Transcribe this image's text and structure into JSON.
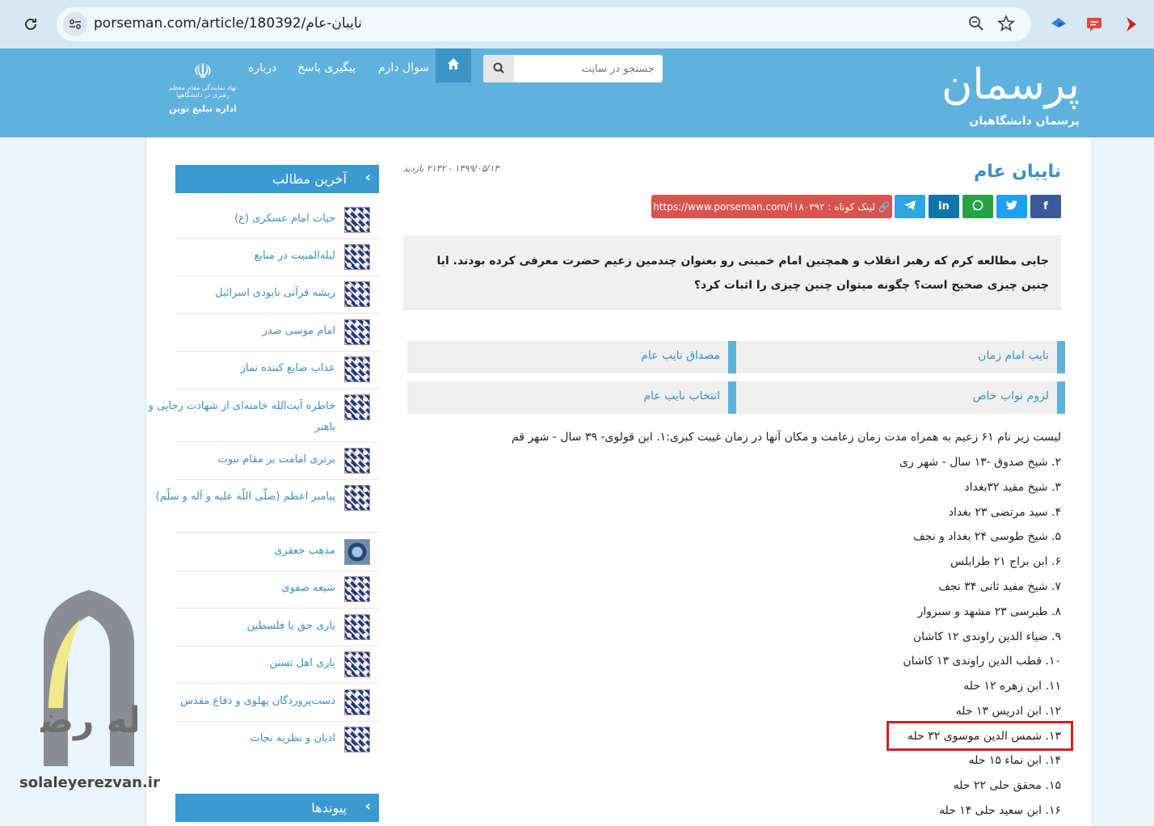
{
  "browser": {
    "url": "porseman.com/article/180392/نایبان-عام"
  },
  "header": {
    "logo_title": "پرسمان",
    "logo_subtitle": "پرسمان دانشگاهیان",
    "search_placeholder": "جستجو در سایت",
    "nav": [
      "سوال دارم",
      "پیگیری پاسخ",
      "درباره"
    ],
    "org_small": "نهاد نمایندگی مقام معظم رهبری در دانشگاهها",
    "org_name": "اداره تبلیغ نوین"
  },
  "article": {
    "title": "نایبان عام",
    "meta": "۱۳۹۹/۰۵/۱۳ - ۲۱۳۲ بازدید",
    "share": [
      "f",
      "t",
      "w",
      "in",
      "tg"
    ],
    "short_link": "لینک کوتاه : https://www.porseman.com/!۱۸۰۳۹۲",
    "question": "جایی مطالعه کرم که رهبر انقلاب و همچنین امام خمینی رو بعنوان چندمین زعیم حضرت معرفی کرده بودند. ایا چنین چیزی صحیح است؟ چگونه میتوان چنین چیزی را اثبات کرد؟",
    "tags": [
      "نایب امام زمان",
      "مصداق نایب عام",
      "لزوم نواب خاص",
      "انتخاب نایب عام"
    ],
    "list_lines": [
      "لیست زیر نام ۶۱ زعیم به همراه مدت زمان زعامت و مکان آنها در زمان غیبت کبری:۱. ابن قولوی- ۳۹ سال - شهر قم",
      "۲. شیخ صدوق -۱۳ سال - شهر ری",
      "۳. شیخ مفید ۳۲بغداد",
      "۴. سید مرتضی ۲۳ بغداد",
      "۵. شیخ طوسی ۲۴ بغداد و نجف",
      "۶. ابن براج ۲۱ طرابلس",
      "۷. شیخ مفید ثانی ۳۴ نجف",
      "۸. طبرسی ۲۳ مشهد و سبزوار",
      "۹. ضیاء الدین راوندی ۱۲ کاشان",
      "۱۰. قطب الدین راوندی ۱۳ کاشان",
      "۱۱. ابن زهره ۱۲ حله",
      "۱۲. ابن ادریس ۱۳ حله",
      "۱۳. شمس الدین موسوی ۳۲ حله",
      "۱۴. ابن نماء ۱۵ حله",
      "۱۵. محقق حلی ۲۲ حله",
      "۱۶. ابن سعید حلی ۱۴ حله"
    ]
  },
  "sidebar": {
    "latest_title": "آخرین مطالب",
    "links_title": "پیوندها",
    "items": [
      "حیات امام عسکری (ع)",
      "لیله‌المبیت در منابع",
      "ریشه قرآنی نابودی اسرائیل",
      "امام موسی صدر",
      "عذاب ضایع کننده نماز",
      "خاطره آیت‌الله خامنه‌ای از شهادت رجایی و باهنر",
      "برتری امامت بر مقام نبوت",
      "پیامبر اعظم (صلّی اللّه علیه و آله و سلّم)",
      "مذهب جعفری",
      "شیعه صفوی",
      "یاری حق یا فلسطین",
      "یاری اهل تسنن",
      "دست‌پروردگان پهلوی و دفاع مقدس",
      "ادیان و نظریه نجات"
    ]
  },
  "watermark": {
    "arch_text": "سلاله رضوان",
    "site": "solaleyerezvan.ir"
  },
  "colors": {
    "header_bg": "#5fb1de",
    "accent": "#3c8fc4",
    "shortlink": "#d9534f",
    "highlight": "#d42027"
  }
}
